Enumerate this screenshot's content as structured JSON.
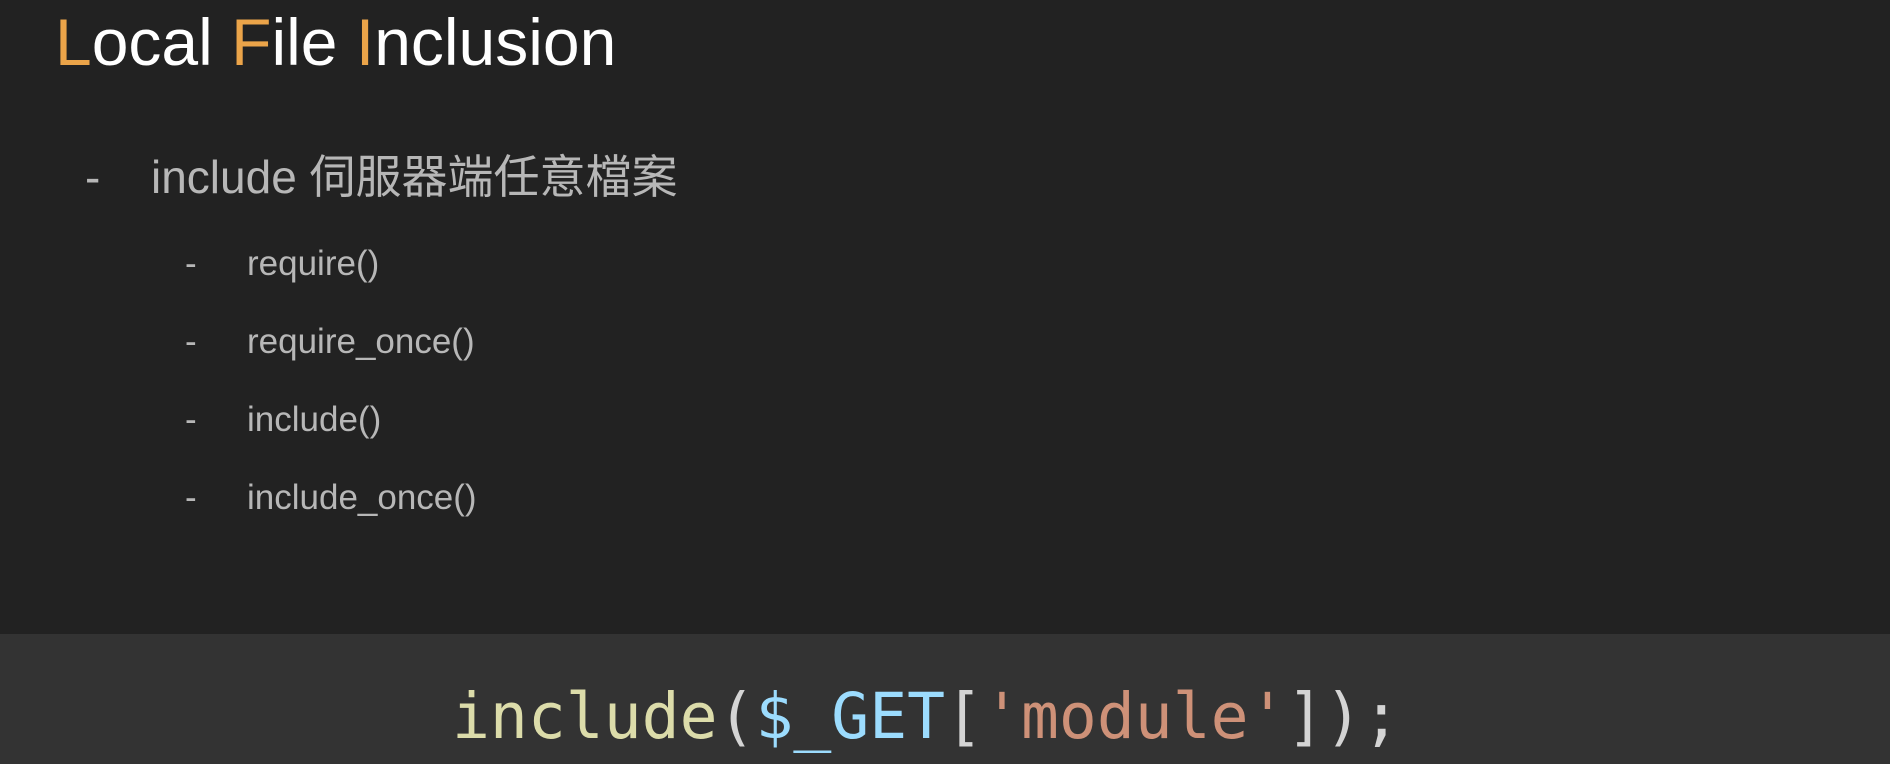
{
  "title": {
    "words": [
      {
        "initial": "L",
        "rest": "ocal "
      },
      {
        "initial": "F",
        "rest": "ile "
      },
      {
        "initial": "I",
        "rest": "nclusion"
      }
    ]
  },
  "bullets": {
    "main": {
      "dash": "-",
      "text": "include 伺服器端任意檔案"
    },
    "sub": [
      {
        "dash": "-",
        "text": "require()"
      },
      {
        "dash": "-",
        "text": "require_once()"
      },
      {
        "dash": "-",
        "text": "include()"
      },
      {
        "dash": "-",
        "text": "include_once()"
      }
    ]
  },
  "code": {
    "tokens": [
      {
        "text": "include",
        "color": "#dcdcaa"
      },
      {
        "text": "(",
        "color": "#d4d4d4"
      },
      {
        "text": "$_GET",
        "color": "#9cdcfe"
      },
      {
        "text": "[",
        "color": "#d4d4d4"
      },
      {
        "text": "'module'",
        "color": "#ce9178"
      },
      {
        "text": "]);",
        "color": "#d4d4d4"
      }
    ]
  },
  "colors": {
    "background": "#222222",
    "code_background": "#333333",
    "title_text": "#ffffff",
    "title_accent": "#eba449",
    "bullet_text": "#b7b7b7"
  }
}
